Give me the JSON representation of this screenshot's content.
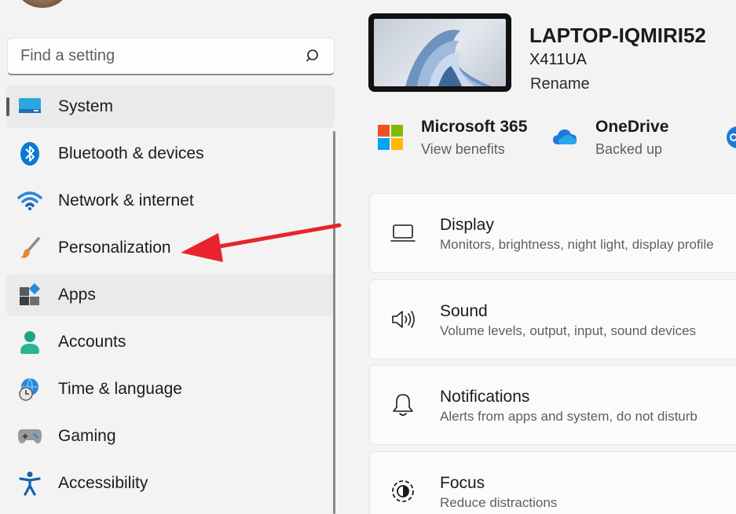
{
  "search": {
    "placeholder": "Find a setting"
  },
  "nav": {
    "items": [
      {
        "label": "System"
      },
      {
        "label": "Bluetooth & devices"
      },
      {
        "label": "Network & internet"
      },
      {
        "label": "Personalization"
      },
      {
        "label": "Apps"
      },
      {
        "label": "Accounts"
      },
      {
        "label": "Time & language"
      },
      {
        "label": "Gaming"
      },
      {
        "label": "Accessibility"
      }
    ]
  },
  "device": {
    "name": "LAPTOP-IQMIRI52",
    "model": "X411UA",
    "rename": "Rename"
  },
  "quick_links": [
    {
      "title": "Microsoft 365",
      "subtitle": "View benefits"
    },
    {
      "title": "OneDrive",
      "subtitle": "Backed up"
    }
  ],
  "cards": [
    {
      "title": "Display",
      "subtitle": "Monitors, brightness, night light, display profile"
    },
    {
      "title": "Sound",
      "subtitle": "Volume levels, output, input, sound devices"
    },
    {
      "title": "Notifications",
      "subtitle": "Alerts from apps and system, do not disturb"
    },
    {
      "title": "Focus",
      "subtitle": "Reduce distractions"
    }
  ],
  "colors": {
    "accent": "#0067c0",
    "annotation_arrow": "#e8232d",
    "selection_bg": "#eaeaea"
  },
  "icons": [
    "search-icon",
    "system-icon",
    "bluetooth-icon",
    "wifi-icon",
    "paintbrush-icon",
    "apps-icon",
    "accounts-icon",
    "time-language-icon",
    "gaming-icon",
    "accessibility-icon",
    "microsoft365-icon",
    "onedrive-icon",
    "display-icon",
    "sound-icon",
    "notifications-icon",
    "focus-icon"
  ]
}
